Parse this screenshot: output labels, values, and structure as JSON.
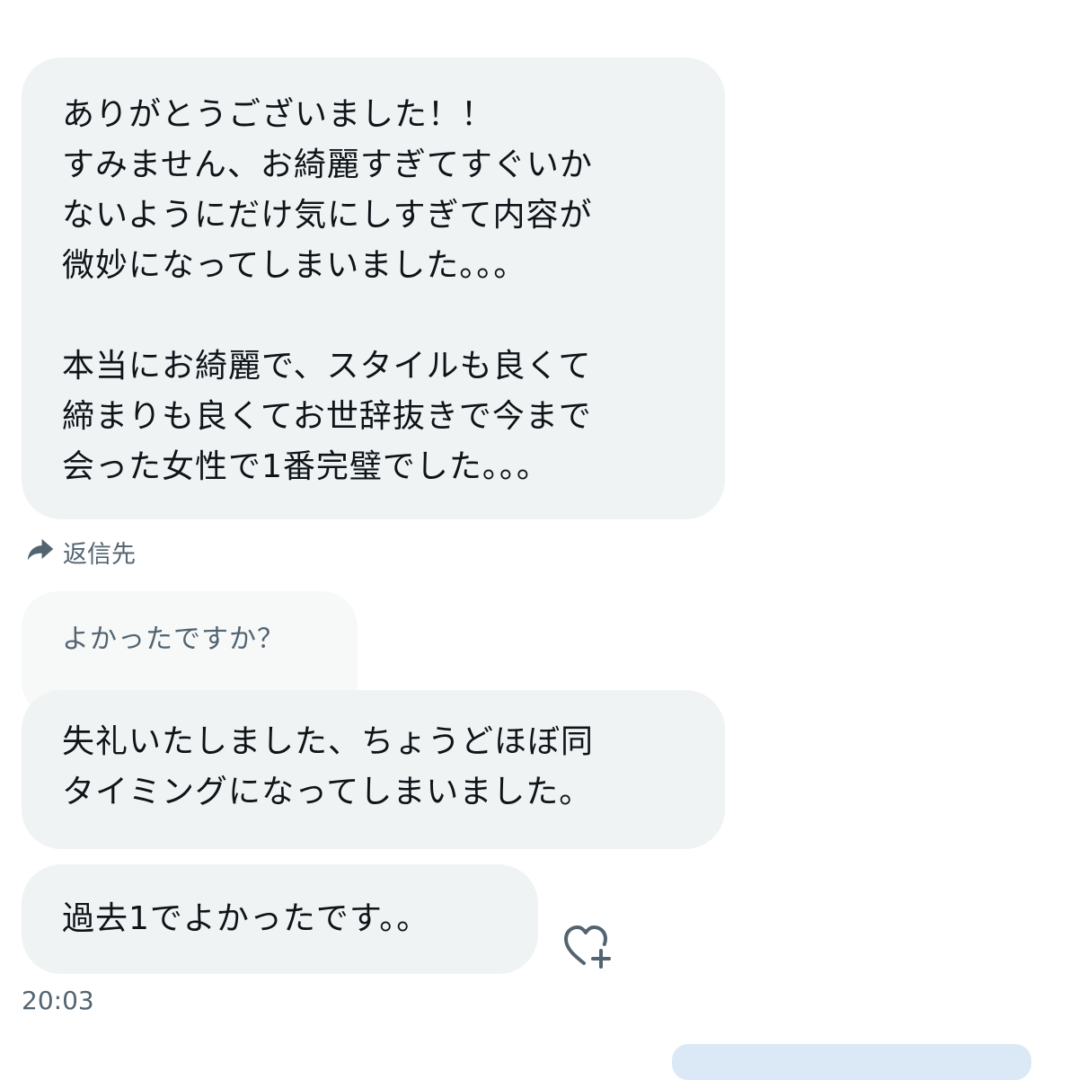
{
  "messages": [
    {
      "text": "ありがとうございました！！\nすみません、お綺麗すぎてすぐいか\nないようにだけ気にしすぎて内容が\n微妙になってしまいました。。。\n\n本当にお綺麗で、スタイルも良くて\n締まりも良くてお世辞抜きで今まで\n会った女性で1番完璧でした。。。"
    },
    {
      "text": "失礼いたしました、ちょうどほぼ同\nタイミングになってしまいました。"
    },
    {
      "text": "過去1でよかったです。。"
    }
  ],
  "reply": {
    "label": "返信先",
    "icon": "reply-arrow-icon",
    "quoted_text": "よかったですか？"
  },
  "actions": {
    "react_icon": "heart-plus-icon"
  },
  "timestamp": "20:03",
  "colors": {
    "bubble_background": "#eff3f4",
    "quoted_background": "#f7f9f9",
    "primary_text": "#0f1419",
    "secondary_text": "#536471"
  }
}
